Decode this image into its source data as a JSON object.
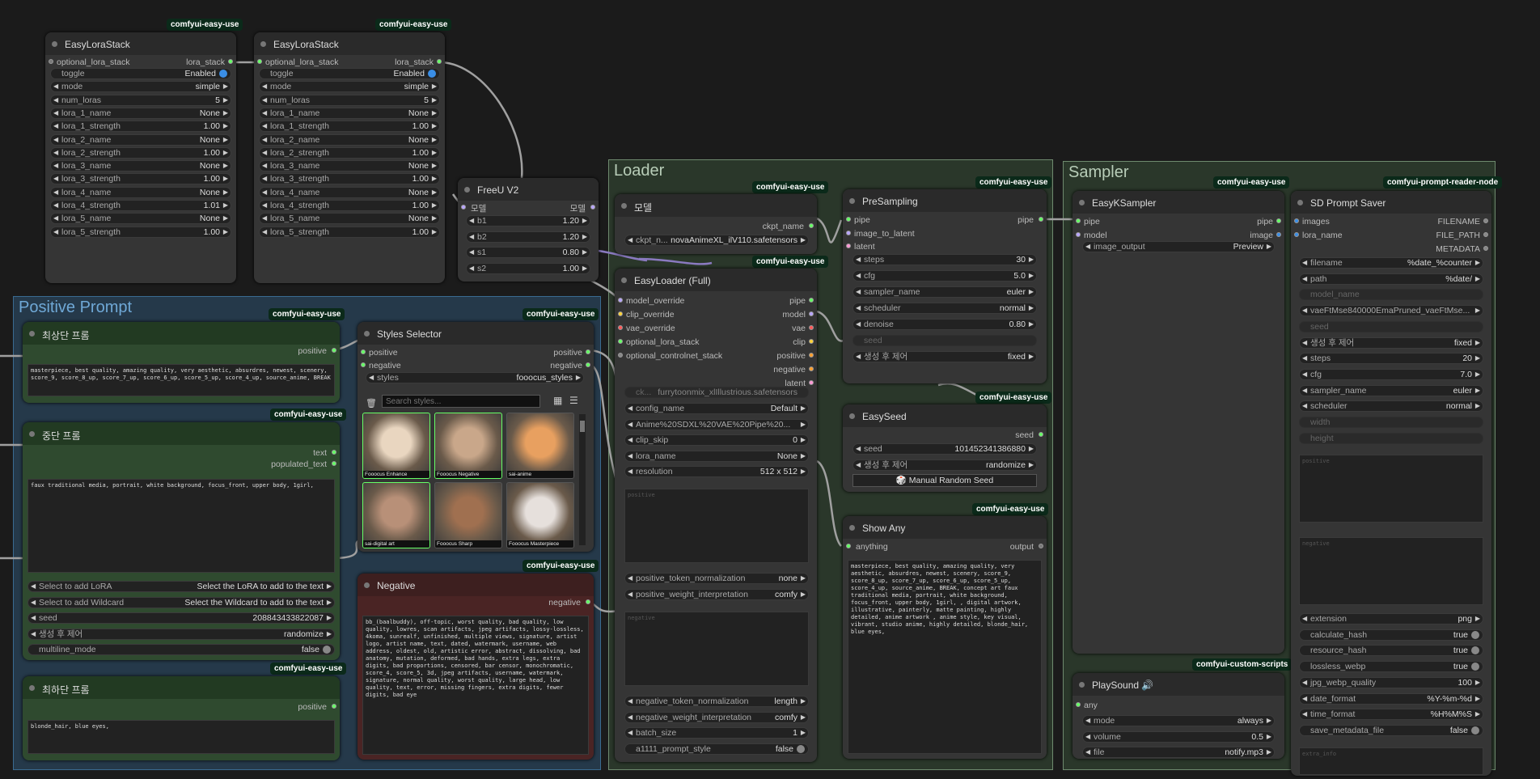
{
  "lora1": {
    "badge": "comfyui-easy-use",
    "title": "EasyLoraStack",
    "in": "optional_lora_stack",
    "out": "lora_stack",
    "widgets": [
      [
        "toggle",
        "Enabled"
      ],
      [
        "mode",
        "simple"
      ],
      [
        "num_loras",
        "5"
      ],
      [
        "lora_1_name",
        "None"
      ],
      [
        "lora_1_strength",
        "1.00"
      ],
      [
        "lora_2_name",
        "None"
      ],
      [
        "lora_2_strength",
        "1.00"
      ],
      [
        "lora_3_name",
        "None"
      ],
      [
        "lora_3_strength",
        "1.00"
      ],
      [
        "lora_4_name",
        "None"
      ],
      [
        "lora_4_strength",
        "1.01"
      ],
      [
        "lora_5_name",
        "None"
      ],
      [
        "lora_5_strength",
        "1.00"
      ]
    ]
  },
  "lora2": {
    "badge": "comfyui-easy-use",
    "title": "EasyLoraStack",
    "in": "optional_lora_stack",
    "out": "lora_stack",
    "widgets": [
      [
        "toggle",
        "Enabled"
      ],
      [
        "mode",
        "simple"
      ],
      [
        "num_loras",
        "5"
      ],
      [
        "lora_1_name",
        "None"
      ],
      [
        "lora_1_strength",
        "1.00"
      ],
      [
        "lora_2_name",
        "None"
      ],
      [
        "lora_2_strength",
        "1.00"
      ],
      [
        "lora_3_name",
        "None"
      ],
      [
        "lora_3_strength",
        "1.00"
      ],
      [
        "lora_4_name",
        "None"
      ],
      [
        "lora_4_strength",
        "1.00"
      ],
      [
        "lora_5_name",
        "None"
      ],
      [
        "lora_5_strength",
        "1.00"
      ]
    ]
  },
  "freeu": {
    "title": "FreeU V2",
    "in": "모델",
    "out": "모델",
    "widgets": [
      [
        "b1",
        "1.20"
      ],
      [
        "b2",
        "1.20"
      ],
      [
        "s1",
        "0.80"
      ],
      [
        "s2",
        "1.00"
      ]
    ]
  },
  "groups": {
    "positive": "Positive Prompt",
    "loader": "Loader",
    "sampler": "Sampler"
  },
  "top_prompt": {
    "badge": "comfyui-easy-use",
    "title": "최상단 프롬",
    "out": "positive",
    "text": "masterpiece, best quality, amazing quality, very aesthetic, absurdres, newest, scenery, score_9, score_8_up, score_7_up, score_6_up, score_5_up, score_4_up, source_anime, BREAK"
  },
  "mid_prompt": {
    "badge": "comfyui-easy-use",
    "title": "중단 프롬",
    "out1": "text",
    "out2": "populated_text",
    "text": "faux traditional media, portrait, white background, focus_front, upper body, 1girl,",
    "widgets": [
      [
        "Select to add LoRA",
        "Select the LoRA to add to the text"
      ],
      [
        "Select to add Wildcard",
        "Select the Wildcard to add to the text"
      ],
      [
        "seed",
        "208843433822087"
      ],
      [
        "생성 후 제어",
        "randomize"
      ],
      [
        "multiline_mode",
        "false"
      ]
    ]
  },
  "bot_prompt": {
    "badge": "comfyui-easy-use",
    "title": "최하단 프롬",
    "out": "positive",
    "text": "blonde_hair, blue eyes,"
  },
  "styles": {
    "badge": "comfyui-easy-use",
    "title": "Styles Selector",
    "in1": "positive",
    "in2": "negative",
    "out1": "positive",
    "out2": "negative",
    "styles_label": "styles",
    "styles_value": "fooocus_styles",
    "search_placeholder": "Search styles...",
    "thumbs": [
      "Fooocus Enhance",
      "Fooocus Negative",
      "sai-anime",
      "sai-digital art",
      "Fooocus Sharp",
      "Fooocus Masterpiece"
    ]
  },
  "negative": {
    "badge": "comfyui-easy-use",
    "title": "Negative",
    "out": "negative",
    "text": "bb_(baalbuddy), off-topic, worst quality, bad quality, low quality, lowres, scan artifacts, jpeg artifacts, lossy-lossless, 4koma, sunrealf, unfinished, multiple views, signature, artist logo, artist name, text, dated, watermark, username, web address, oldest, old, artistic error, abstract, dissolving, bad anatomy, mutation, deformed, bad hands, extra legs, extra digits, bad proportions, censored, bar censor, monochromatic, score_4, score_5, 3d, jpeg artifacts, username, watermark, signature, normal quality, worst quality, large head, low quality, text, error, missing fingers, extra digits, fewer digits, bad eye"
  },
  "model": {
    "badge": "comfyui-easy-use",
    "title": "모델",
    "out": "ckpt_name",
    "w_label": "ckpt_n...",
    "w_value": "novaAnimeXL_ilV110.safetensors"
  },
  "loader": {
    "badge": "comfyui-easy-use",
    "title": "EasyLoader (Full)",
    "ins": [
      "model_override",
      "clip_override",
      "vae_override",
      "optional_lora_stack",
      "optional_controlnet_stack"
    ],
    "outs": [
      "pipe",
      "model",
      "vae",
      "clip",
      "positive",
      "negative",
      "latent"
    ],
    "ckpt": "furrytoonmix_xlIllustrious.safetensors",
    "widgets": [
      [
        "config_name",
        "Default"
      ],
      [
        "Anime%20SDXL%20VAE%20Pipe%20...",
        ""
      ],
      [
        "clip_skip",
        "0"
      ],
      [
        "lora_name",
        "None"
      ],
      [
        "resolution",
        "512 x 512"
      ]
    ],
    "pos_ph": "positive",
    "neg_ph": "negative",
    "widgets2": [
      [
        "positive_token_normalization",
        "none"
      ],
      [
        "positive_weight_interpretation",
        "comfy"
      ]
    ],
    "widgets3": [
      [
        "negative_token_normalization",
        "length"
      ],
      [
        "negative_weight_interpretation",
        "comfy"
      ],
      [
        "batch_size",
        "1"
      ],
      [
        "a1111_prompt_style",
        "false"
      ]
    ]
  },
  "presampling": {
    "badge": "comfyui-easy-use",
    "title": "PreSampling",
    "ins": [
      "pipe",
      "image_to_latent",
      "latent"
    ],
    "out": "pipe",
    "widgets": [
      [
        "steps",
        "30"
      ],
      [
        "cfg",
        "5.0"
      ],
      [
        "sampler_name",
        "euler"
      ],
      [
        "scheduler",
        "normal"
      ],
      [
        "denoise",
        "0.80"
      ],
      [
        "seed",
        ""
      ],
      [
        "생성 후 제어",
        "fixed"
      ]
    ]
  },
  "easyseed": {
    "badge": "comfyui-easy-use",
    "title": "EasySeed",
    "out": "seed",
    "widgets": [
      [
        "seed",
        "101452341386880"
      ],
      [
        "생성 후 제어",
        "randomize"
      ]
    ],
    "button": "🎲 Manual Random Seed"
  },
  "showany": {
    "badge": "comfyui-easy-use",
    "title": "Show Any",
    "in": "anything",
    "out": "output",
    "text": "masterpiece, best quality, amazing quality, very aesthetic, absurdres, newest, scenery, score_9, score_8_up, score_7_up, score_6_up, score_5_up, score_4_up, source_anime, BREAK, concept art faux traditional media, portrait, white background, focus_front, upper body, 1girl, , digital artwork, illustrative, painterly, matte painting, highly detailed, anime artwork , anime style, key visual, vibrant, studio anime, highly detailed, blonde_hair, blue eyes,"
  },
  "ksampler": {
    "badge": "comfyui-easy-use",
    "title": "EasyKSampler",
    "ins": [
      "pipe",
      "model"
    ],
    "outs": [
      "pipe",
      "image"
    ],
    "w_label": "image_output",
    "w_value": "Preview"
  },
  "playsound": {
    "badge": "comfyui-custom-scripts",
    "title": "PlaySound 🔊",
    "in": "any",
    "widgets": [
      [
        "mode",
        "always"
      ],
      [
        "volume",
        "0.5"
      ],
      [
        "file",
        "notify.mp3"
      ]
    ]
  },
  "saver": {
    "badge": "comfyui-prompt-reader-node",
    "title": "SD Prompt Saver",
    "ins": [
      "images",
      "lora_name"
    ],
    "outs": [
      "FILENAME",
      "FILE_PATH",
      "METADATA"
    ],
    "widgets": [
      [
        "filename",
        "%date_%counter"
      ],
      [
        "path",
        "%date/"
      ],
      [
        "model_name",
        ""
      ],
      [
        "vaeFtMse840000EmaPruned_vaeFtMse...",
        ""
      ],
      [
        "seed",
        ""
      ],
      [
        "생성 후 제어",
        "fixed"
      ],
      [
        "steps",
        "20"
      ],
      [
        "cfg",
        "7.0"
      ],
      [
        "sampler_name",
        "euler"
      ],
      [
        "scheduler",
        "normal"
      ],
      [
        "width",
        ""
      ],
      [
        "height",
        ""
      ]
    ],
    "pos_ph": "positive",
    "neg_ph": "negative",
    "widgets2": [
      [
        "extension",
        "png"
      ],
      [
        "calculate_hash",
        "true"
      ],
      [
        "resource_hash",
        "true"
      ],
      [
        "lossless_webp",
        "true"
      ],
      [
        "jpg_webp_quality",
        "100"
      ],
      [
        "date_format",
        "%Y-%m-%d"
      ],
      [
        "time_format",
        "%H%M%S"
      ],
      [
        "save_metadata_file",
        "false"
      ]
    ],
    "extra_ph": "extra_info"
  },
  "colors": {
    "accent": "#3a8ee6",
    "badge_bg": "#0b2a1a",
    "group_blue": "#2f5a7a",
    "group_green": "#506b50",
    "wire": "#a0a0a0"
  }
}
